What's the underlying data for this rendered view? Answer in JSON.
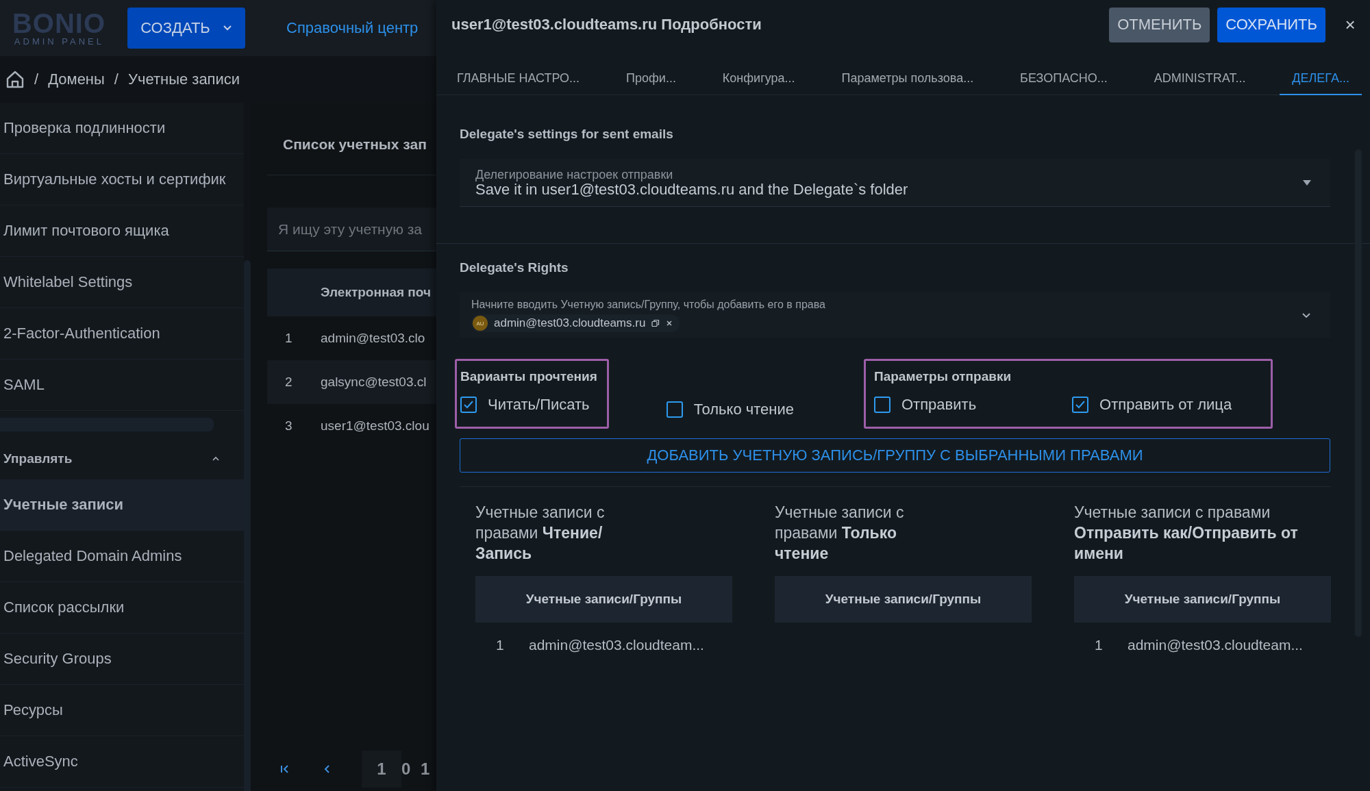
{
  "header": {
    "logo_text": "BONIO",
    "logo_subtitle": "ADMIN PANEL",
    "create_button": "СОЗДАТЬ",
    "help_link": "Справочный центр"
  },
  "breadcrumbs": {
    "separator": "/",
    "items": [
      "Домены",
      "Учетные записи"
    ]
  },
  "sidebar": {
    "items": [
      {
        "label": "Проверка подлинности",
        "selected": false
      },
      {
        "label": "Виртуальные хосты и сертифик",
        "selected": false
      },
      {
        "label": "Лимит почтового ящика",
        "selected": false
      },
      {
        "label": "Whitelabel Settings",
        "selected": false
      },
      {
        "label": "2-Factor-Authentication",
        "selected": false
      },
      {
        "label": "SAML",
        "selected": false
      }
    ],
    "section": {
      "label": "Управлять",
      "expanded": true,
      "items": [
        {
          "label": "Учетные записи",
          "selected": true
        },
        {
          "label": "Delegated Domain Admins",
          "selected": false
        },
        {
          "label": "Список рассылки",
          "selected": false
        },
        {
          "label": "Security Groups",
          "selected": false
        },
        {
          "label": "Ресурсы",
          "selected": false
        },
        {
          "label": "ActiveSync",
          "selected": false
        }
      ]
    }
  },
  "account_list": {
    "title": "Список учетных зап",
    "search": {
      "placeholder": "Я ищу эту учетную за"
    },
    "columns": [
      "Электронная поч"
    ],
    "rows": [
      {
        "index": "1",
        "email": "admin@test03.clo"
      },
      {
        "index": "2",
        "email": "galsync@test03.cl"
      },
      {
        "index": "3",
        "email": "user1@test03.clou"
      }
    ],
    "pagination": {
      "page": "1",
      "total": "0 1"
    }
  },
  "dialog": {
    "title": "user1@test03.cloudteams.ru Подробности",
    "cancel_button": "ОТМЕНИТЬ",
    "save_button": "СОХРАНИТЬ",
    "close": "×",
    "tabs": [
      {
        "label": "ГЛАВНЫЕ НАСТРО...",
        "selected": false
      },
      {
        "label": "Профи...",
        "selected": false
      },
      {
        "label": "Конфигура...",
        "selected": false
      },
      {
        "label": "Параметры пользова...",
        "selected": false
      },
      {
        "label": "БЕЗОПАСНО...",
        "selected": false
      },
      {
        "label": "ADMINISTRAT...",
        "selected": false
      },
      {
        "label": "ДЕЛЕГА...",
        "selected": true
      }
    ],
    "sent_settings": {
      "heading": "Delegate's settings for sent emails",
      "field": {
        "label": "Делегирование настроек отправки",
        "value": "Save it in user1@test03.cloudteams.ru and the Delegate`s folder"
      }
    },
    "rights": {
      "heading": "Delegate's Rights",
      "field": {
        "placeholder": "Начните вводить Учетную запись/Группу, чтобы добавить его в права",
        "chips": [
          {
            "initials": "AU",
            "label": "admin@test03.cloudteams.ru"
          }
        ]
      },
      "groups": [
        {
          "label": "Варианты прочтения",
          "highlighted": true,
          "options": [
            {
              "label": "Читать/Писать",
              "checked": true,
              "highlighted": true
            },
            {
              "label": "Только чтение",
              "checked": false,
              "highlighted": false
            }
          ]
        },
        {
          "label": "Параметры отправки",
          "highlighted": true,
          "options": [
            {
              "label": "Отправить",
              "checked": false,
              "highlighted": true
            },
            {
              "label": "Отправить от лица",
              "checked": true,
              "highlighted": true
            }
          ]
        }
      ],
      "add_button": "ДОБАВИТЬ УЧЕТНУЮ ЗАПИСЬ/ГРУППУ С ВЫБРАННЫМИ ПРАВАМИ"
    },
    "lists": [
      {
        "title": "Учетные записи с правами **Чтение/ Запись**",
        "column": "Учетные записи/Группы",
        "rows": [
          {
            "index": "1",
            "account": "admin@test03.cloudteam..."
          }
        ]
      },
      {
        "title": "Учетные записи с правами **Только чтение**",
        "column": "Учетные записи/Группы"
      },
      {
        "title": "Учетные записи с правами **Отправить как/Отправить от имени**",
        "column": "Учетные записи/Группы",
        "rows": [
          {
            "index": "1",
            "account": "admin@test03.cloudteam..."
          }
        ]
      }
    ]
  }
}
